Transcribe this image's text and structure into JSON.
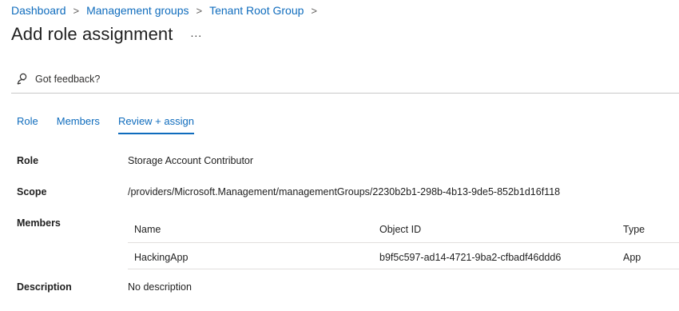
{
  "breadcrumb": {
    "items": [
      "Dashboard",
      "Management groups",
      "Tenant Root Group"
    ],
    "separator": ">"
  },
  "header": {
    "title": "Add role assignment",
    "more_label": "..."
  },
  "feedback": {
    "label": "Got feedback?",
    "icon": "feedback-icon"
  },
  "tabs": [
    {
      "label": "Role",
      "active": false
    },
    {
      "label": "Members",
      "active": false
    },
    {
      "label": "Review + assign",
      "active": true
    }
  ],
  "details": {
    "role_label": "Role",
    "role_value": "Storage Account Contributor",
    "scope_label": "Scope",
    "scope_value": "/providers/Microsoft.Management/managementGroups/2230b2b1-298b-4b13-9de5-852b1d16f118",
    "members_label": "Members",
    "description_label": "Description",
    "description_value": "No description"
  },
  "members_table": {
    "columns": [
      "Name",
      "Object ID",
      "Type"
    ],
    "rows": [
      [
        "HackingApp",
        "b9f5c597-ad14-4721-9ba2-cfbadf46ddd6",
        "App"
      ]
    ]
  },
  "colors": {
    "accent": "#0f6cbd",
    "text": "#1f1f1f",
    "divider": "#c8c8c8"
  }
}
